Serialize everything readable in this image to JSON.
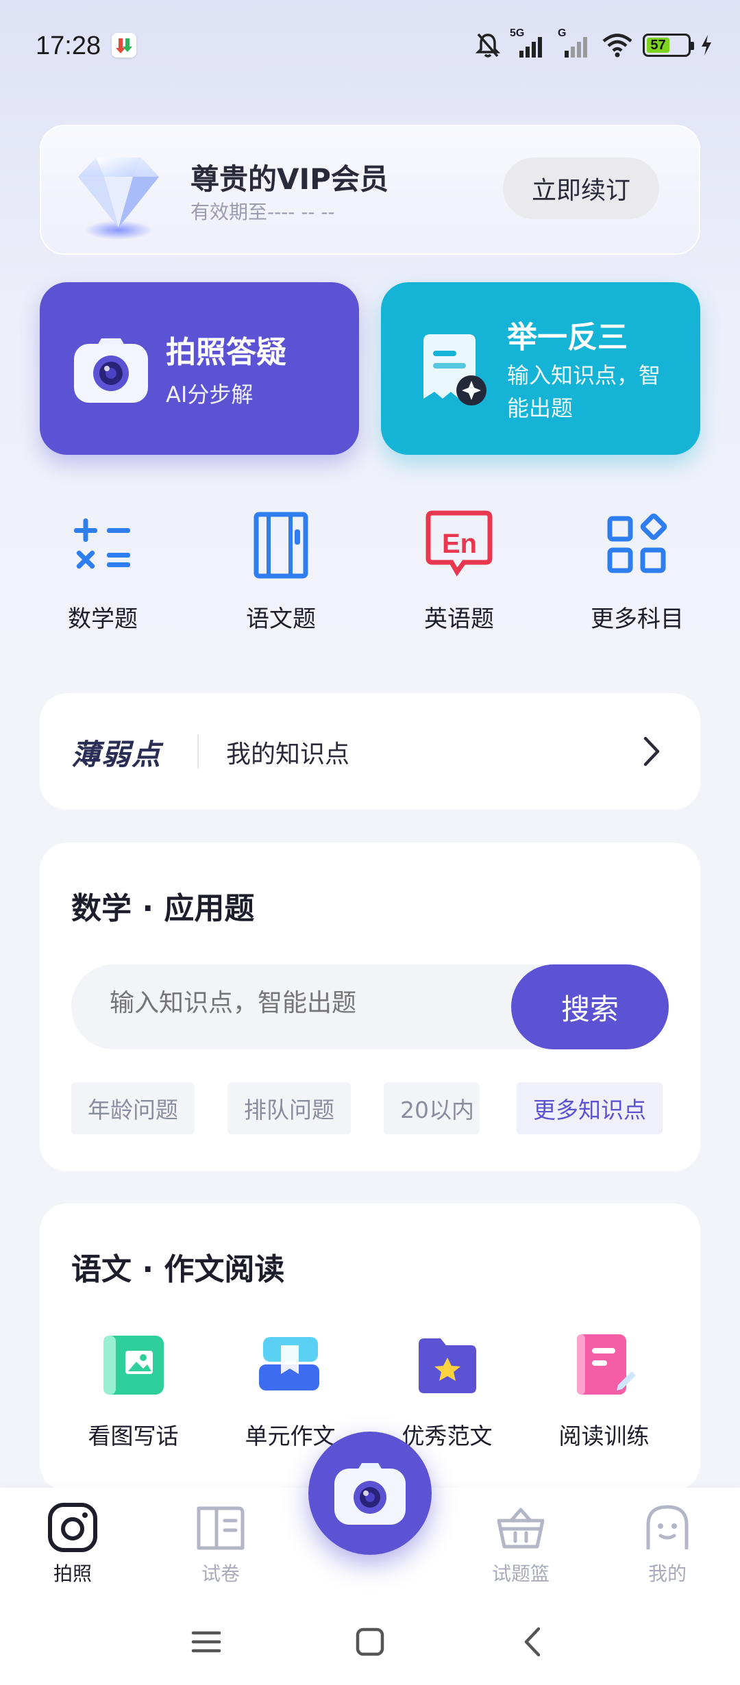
{
  "status_bar": {
    "time": "17:28",
    "network_label": "5G",
    "network_label_2": "G",
    "battery_level": "57",
    "battery_percent": 57,
    "icons": [
      "bell-off-icon",
      "signal-icon",
      "signal-icon",
      "wifi-icon",
      "battery-icon",
      "charging-icon"
    ]
  },
  "vip": {
    "title": "尊贵的VIP会员",
    "expire": "有效期至---- -- --",
    "renew_label": "立即续订",
    "icon": "diamond-icon"
  },
  "features": [
    {
      "title": "拍照答疑",
      "subtitle": "AI分步解",
      "icon": "camera-icon",
      "color": "#5b53d3"
    },
    {
      "title": "举一反三",
      "subtitle": "输入知识点，智能出题",
      "icon": "document-sparkle-icon",
      "color": "#15b3d6"
    }
  ],
  "subjects": [
    {
      "label": "数学题",
      "icon": "math-operators-icon"
    },
    {
      "label": "语文题",
      "icon": "notebook-icon"
    },
    {
      "label": "英语题",
      "icon": "english-en-icon"
    },
    {
      "label": "更多科目",
      "icon": "grid-apps-icon"
    }
  ],
  "weak": {
    "logo": "薄弱点",
    "text": "我的知识点",
    "icon": "chevron-right-icon"
  },
  "math": {
    "title": "数学 · 应用题",
    "search_placeholder": "输入知识点，智能出题",
    "search_label": "搜索",
    "tags": [
      "年龄问题",
      "排队问题",
      "20以内"
    ],
    "more_label": "更多知识点"
  },
  "chinese": {
    "title": "语文 · 作文阅读",
    "items": [
      {
        "label": "看图写话",
        "icon": "picture-book-icon"
      },
      {
        "label": "单元作文",
        "icon": "bookmark-stack-icon"
      },
      {
        "label": "优秀范文",
        "icon": "star-folder-icon"
      },
      {
        "label": "阅读训练",
        "icon": "pink-notebook-icon"
      }
    ]
  },
  "bottom_nav": [
    {
      "label": "拍照",
      "icon": "photo-lens-icon",
      "active": true
    },
    {
      "label": "试卷",
      "icon": "exam-paper-icon",
      "active": false
    },
    {
      "label": "试题篮",
      "icon": "basket-icon",
      "active": false
    },
    {
      "label": "我的",
      "icon": "profile-face-icon",
      "active": false
    }
  ],
  "colors": {
    "accent": "#5b53d3",
    "teal": "#15b3d6",
    "english_red": "#e8384f",
    "math_blue": "#2f7ef0"
  }
}
